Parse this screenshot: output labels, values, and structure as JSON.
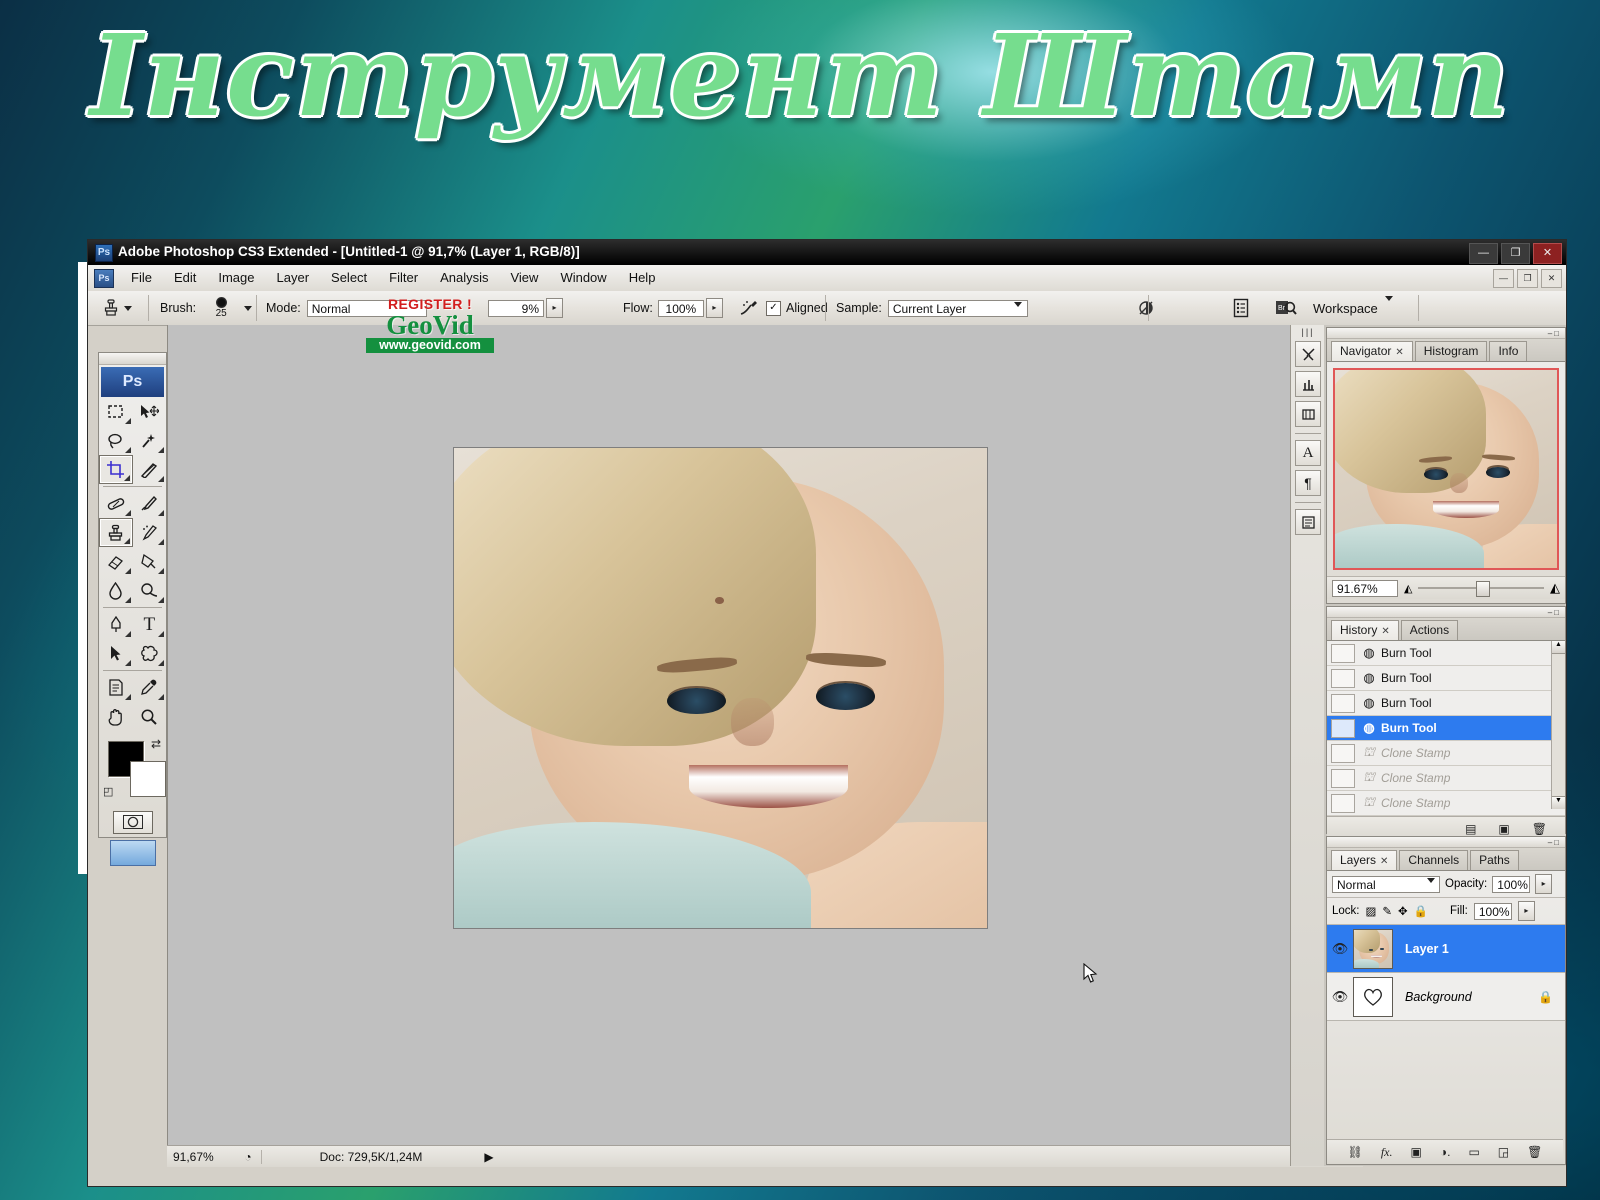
{
  "slide": {
    "title": "Інструмент Штамп",
    "title_color": "#76dd8e"
  },
  "window": {
    "title": "Adobe Photoshop CS3 Extended - [Untitled-1 @ 91,7% (Layer 1, RGB/8)]",
    "app_badge": "Ps",
    "buttons": {
      "minimize": "—",
      "restore": "❐",
      "close": "✕"
    },
    "doc_buttons": {
      "minimize": "—",
      "restore": "❐",
      "close": "✕"
    }
  },
  "menu": {
    "badge": "Ps",
    "items": [
      "File",
      "Edit",
      "Image",
      "Layer",
      "Select",
      "Filter",
      "Analysis",
      "View",
      "Window",
      "Help"
    ]
  },
  "options_bar": {
    "tool_icon": "clone-stamp-icon",
    "brush_label": "Brush:",
    "brush_size": "25",
    "mode_label": "Mode:",
    "mode_value": "Normal",
    "opacity_value": "9%",
    "flow_label": "Flow:",
    "flow_value": "100%",
    "airbrush_icon": "airbrush-icon",
    "aligned_checked": "✓",
    "aligned_label": "Aligned",
    "sample_label": "Sample:",
    "sample_value": "Current Layer",
    "ignore_adjustment_icon": "ignore-adjustment-layers-icon",
    "palette_toggle_icon": "palettes-icon",
    "bridge_icon": "go-to-bridge-icon",
    "workspace_label": "Workspace"
  },
  "watermark": {
    "register": "REGISTER !",
    "brand": "GeoVid",
    "url": "www.geovid.com"
  },
  "toolbox": {
    "badge": "Ps",
    "tools": [
      {
        "name": "marquee-tool",
        "glyph": "▢",
        "selected": false,
        "submenu": true
      },
      {
        "name": "move-tool",
        "glyph": "✥",
        "selected": false,
        "submenu": false
      },
      {
        "name": "lasso-tool",
        "glyph": "◌",
        "selected": false,
        "submenu": true
      },
      {
        "name": "magic-wand-tool",
        "glyph": "✳",
        "selected": false,
        "submenu": true
      },
      {
        "name": "crop-tool",
        "glyph": "✜",
        "selected": true,
        "submenu": true
      },
      {
        "name": "slice-tool",
        "glyph": "✂",
        "selected": false,
        "submenu": true
      },
      {
        "name": "healing-brush-tool",
        "glyph": "✎",
        "selected": false,
        "submenu": true
      },
      {
        "name": "brush-tool",
        "glyph": "🖌",
        "selected": false,
        "submenu": true
      },
      {
        "name": "clone-stamp-tool",
        "glyph": "⛫",
        "selected": true,
        "submenu": true
      },
      {
        "name": "history-brush-tool",
        "glyph": "✒",
        "selected": false,
        "submenu": true
      },
      {
        "name": "eraser-tool",
        "glyph": "⌫",
        "selected": false,
        "submenu": true
      },
      {
        "name": "gradient-tool",
        "glyph": "◨",
        "selected": false,
        "submenu": true
      },
      {
        "name": "blur-tool",
        "glyph": "💧",
        "selected": false,
        "submenu": true
      },
      {
        "name": "dodge-tool",
        "glyph": "◍",
        "selected": false,
        "submenu": true
      },
      {
        "name": "pen-tool",
        "glyph": "✑",
        "selected": false,
        "submenu": true
      },
      {
        "name": "type-tool",
        "glyph": "T",
        "selected": false,
        "submenu": true
      },
      {
        "name": "path-selection-tool",
        "glyph": "➤",
        "selected": false,
        "submenu": true
      },
      {
        "name": "custom-shape-tool",
        "glyph": "✦",
        "selected": false,
        "submenu": true
      },
      {
        "name": "notes-tool",
        "glyph": "🗒",
        "selected": false,
        "submenu": true
      },
      {
        "name": "eyedropper-tool",
        "glyph": "⚲",
        "selected": false,
        "submenu": true
      },
      {
        "name": "hand-tool",
        "glyph": "✋",
        "selected": false,
        "submenu": false
      },
      {
        "name": "zoom-tool",
        "glyph": "🔍",
        "selected": false,
        "submenu": false
      }
    ],
    "foreground_color": "#000000",
    "background_color": "#ffffff",
    "swap_icon": "swap-colors-icon",
    "default_icon": "default-colors-icon",
    "quick_mask_icon": "quick-mask-icon",
    "screen_mode_icon": "screen-mode-icon"
  },
  "dock_icons": [
    {
      "name": "tool-presets-icon",
      "glyph": "✂"
    },
    {
      "name": "brushes-icon",
      "glyph": "⑂"
    },
    {
      "name": "clone-source-icon",
      "glyph": "▥"
    },
    {
      "name": "character-icon",
      "glyph": "A"
    },
    {
      "name": "paragraph-icon",
      "glyph": "¶"
    },
    {
      "name": "layer-comps-icon",
      "glyph": "▤"
    }
  ],
  "navigator": {
    "tabs": [
      {
        "label": "Navigator",
        "closable": true,
        "active": true
      },
      {
        "label": "Histogram",
        "closable": false,
        "active": false
      },
      {
        "label": "Info",
        "closable": false,
        "active": false
      }
    ],
    "zoom_value": "91.67%",
    "zoom_out_icon": "zoom-out-icon",
    "zoom_in_icon": "zoom-in-icon"
  },
  "history": {
    "tabs": [
      {
        "label": "History",
        "closable": true,
        "active": true
      },
      {
        "label": "Actions",
        "closable": false,
        "active": false
      }
    ],
    "rows": [
      {
        "label": "Burn Tool",
        "icon": "burn-tool-icon",
        "state": "done"
      },
      {
        "label": "Burn Tool",
        "icon": "burn-tool-icon",
        "state": "done"
      },
      {
        "label": "Burn Tool",
        "icon": "burn-tool-icon",
        "state": "done"
      },
      {
        "label": "Burn Tool",
        "icon": "burn-tool-icon",
        "state": "selected"
      },
      {
        "label": "Clone Stamp",
        "icon": "clone-stamp-icon",
        "state": "undone"
      },
      {
        "label": "Clone Stamp",
        "icon": "clone-stamp-icon",
        "state": "undone"
      },
      {
        "label": "Clone Stamp",
        "icon": "clone-stamp-icon",
        "state": "undone"
      }
    ],
    "footer_icons": [
      {
        "name": "create-document-from-state-icon",
        "glyph": "▤"
      },
      {
        "name": "create-new-snapshot-icon",
        "glyph": "▣"
      },
      {
        "name": "delete-state-icon",
        "glyph": "🗑"
      }
    ]
  },
  "layers": {
    "tabs": [
      {
        "label": "Layers",
        "closable": true,
        "active": true
      },
      {
        "label": "Channels",
        "closable": false,
        "active": false
      },
      {
        "label": "Paths",
        "closable": false,
        "active": false
      }
    ],
    "blend_mode": "Normal",
    "opacity_label": "Opacity:",
    "opacity_value": "100%",
    "lock_label": "Lock:",
    "lock_icons": [
      {
        "name": "lock-transparent-pixels-icon",
        "glyph": "▨"
      },
      {
        "name": "lock-image-pixels-icon",
        "glyph": "✎"
      },
      {
        "name": "lock-position-icon",
        "glyph": "✥"
      },
      {
        "name": "lock-all-icon",
        "glyph": "🔒"
      }
    ],
    "fill_label": "Fill:",
    "fill_value": "100%",
    "rows": [
      {
        "name": "Layer 1",
        "selected": true,
        "locked": false,
        "thumb": "portrait"
      },
      {
        "name": "Background",
        "selected": false,
        "locked": true,
        "thumb": "heart"
      }
    ],
    "footer_icons": [
      {
        "name": "link-layers-icon",
        "glyph": "⛓"
      },
      {
        "name": "layer-style-icon",
        "glyph": "fx"
      },
      {
        "name": "layer-mask-icon",
        "glyph": "▣"
      },
      {
        "name": "adjustment-layer-icon",
        "glyph": "◑"
      },
      {
        "name": "new-group-icon",
        "glyph": "▭"
      },
      {
        "name": "new-layer-icon",
        "glyph": "▢"
      },
      {
        "name": "delete-layer-icon",
        "glyph": "🗑"
      }
    ]
  },
  "status_bar": {
    "zoom_value": "91,67%",
    "doc_info": "Doc: 729,5K/1,24M",
    "arrow_icon": "status-arrow-icon",
    "clock_icon": "preview-clock-icon"
  }
}
